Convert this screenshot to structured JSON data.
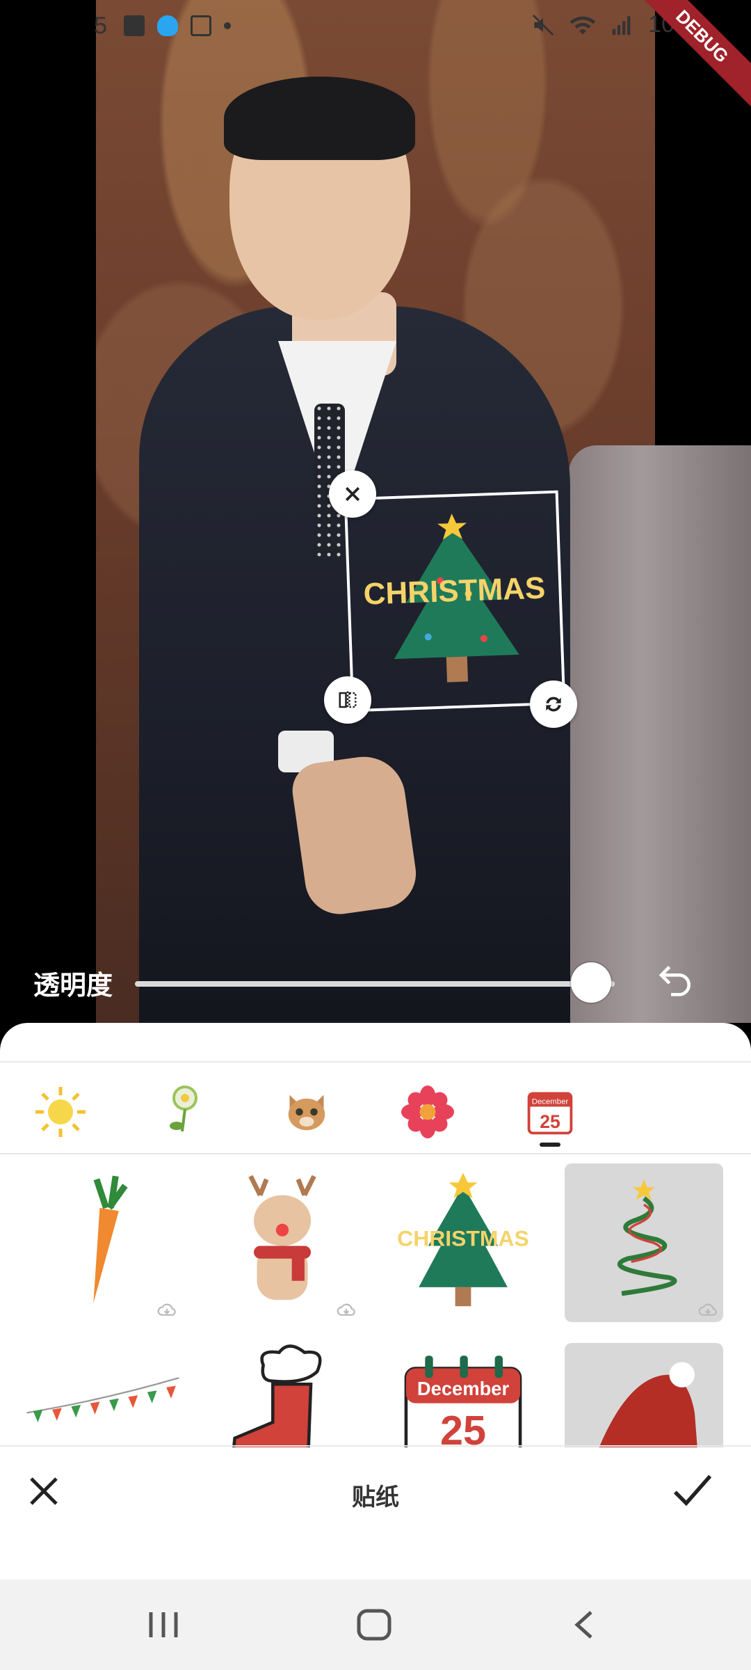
{
  "status_bar": {
    "time_partial": "5",
    "battery_partial": "10",
    "debug_label": "DEBUG"
  },
  "editor": {
    "opacity_label": "透明度",
    "opacity_value": 0.95
  },
  "sticker_tabs": [
    {
      "name": "sun-sticker-tab"
    },
    {
      "name": "flower-balloon-sticker-tab"
    },
    {
      "name": "cat-sticker-tab"
    },
    {
      "name": "red-flower-sticker-tab"
    },
    {
      "name": "calendar-christmas-sticker-tab",
      "selected": true,
      "calendar_month": "December",
      "calendar_day": "25"
    }
  ],
  "stickers_row1": [
    {
      "name": "carrot-sticker",
      "downloadable": true
    },
    {
      "name": "reindeer-sticker",
      "downloadable": true
    },
    {
      "name": "christmas-tree-text-sticker",
      "downloadable": false,
      "text": "CHRISTMAS"
    },
    {
      "name": "ribbon-tree-sticker",
      "downloadable": true,
      "selected": true
    }
  ],
  "stickers_row2": [
    {
      "name": "bunting-flags-sticker"
    },
    {
      "name": "christmas-stocking-sticker"
    },
    {
      "name": "december-calendar-sticker",
      "month": "December",
      "day": "25"
    },
    {
      "name": "santa-hat-sticker"
    }
  ],
  "placed_sticker": {
    "text": "CHRISTMAS"
  },
  "bottom_bar": {
    "title": "贴纸"
  },
  "colors": {
    "accent": "#222222",
    "sheet_bg": "#ffffff",
    "selected_cell": "#d8d8d8",
    "debug_ribbon": "#a0222a"
  }
}
